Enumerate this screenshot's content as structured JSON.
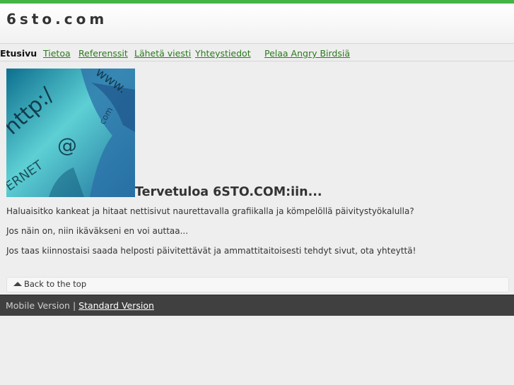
{
  "site": {
    "title": "6sto.com"
  },
  "nav": {
    "active": "Etusivu",
    "links": [
      "Tietoa",
      "Referenssit",
      "Lähetä viesti",
      "Yhteystiedot",
      "Pelaa Angry Birdsiä"
    ]
  },
  "hero": {
    "image_text": [
      "http:/",
      "www.",
      "@",
      "com",
      "TERNET"
    ]
  },
  "content": {
    "heading": "Tervetuloa 6STO.COM:iin...",
    "paragraphs": [
      "Haluaisitko kankeat ja hitaat nettisivut naurettavalla grafiikalla ja kömpelöllä päivitystyökalulla?",
      "Jos näin on, niin ikäväkseni en voi auttaa...",
      "Jos taas kiinnostaisi saada helposti päivitettävät ja ammattitaitoisesti tehdyt sivut, ota yhteyttä!"
    ]
  },
  "back_to_top": {
    "label": "Back to the top",
    "icon": "triangle-up-icon"
  },
  "footer": {
    "mobile_label": "Mobile Version",
    "separator": "|",
    "standard_link": "Standard Version"
  },
  "colors": {
    "accent_bar": "#45b545",
    "link": "#2a7a1c",
    "footer_bg": "#404040",
    "page_bg": "#eeeeee"
  }
}
